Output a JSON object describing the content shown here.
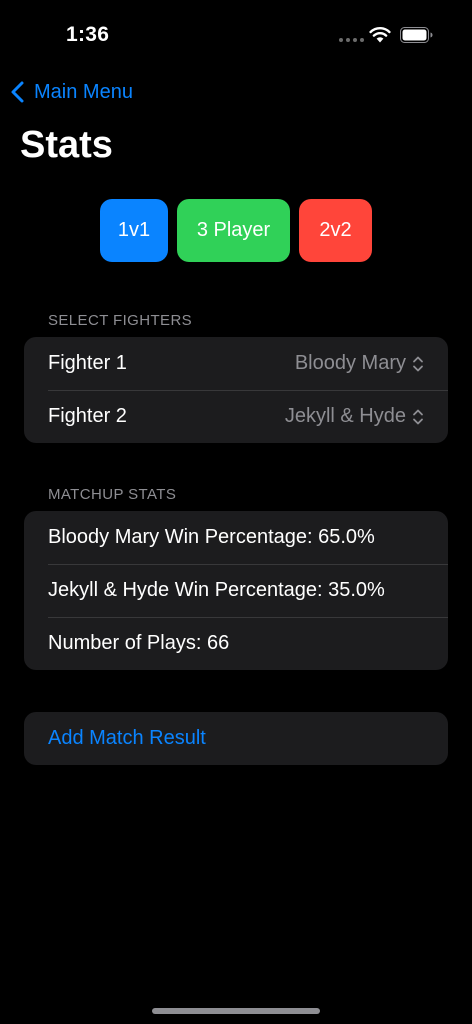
{
  "status_bar": {
    "time": "1:36"
  },
  "nav": {
    "back_label": "Main Menu",
    "title": "Stats"
  },
  "modes": [
    {
      "label": "1v1",
      "color": "#0a84ff"
    },
    {
      "label": "3 Player",
      "color": "#30d158"
    },
    {
      "label": "2v2",
      "color": "#ff453a"
    }
  ],
  "select_fighters": {
    "header": "SELECT FIGHTERS",
    "rows": [
      {
        "label": "Fighter 1",
        "value": "Bloody Mary"
      },
      {
        "label": "Fighter 2",
        "value": "Jekyll & Hyde"
      }
    ]
  },
  "matchup_stats": {
    "header": "MATCHUP STATS",
    "rows": [
      "Bloody Mary Win Percentage: 65.0%",
      "Jekyll & Hyde Win Percentage: 35.0%",
      "Number of Plays: 66"
    ]
  },
  "actions": {
    "add_match": "Add Match Result"
  },
  "colors": {
    "accent": "#0a84ff",
    "background": "#000000",
    "cell": "#1c1c1e",
    "secondary_text": "#8e8e93"
  },
  "icons": [
    "wifi-icon",
    "battery-icon",
    "chevron-left-icon",
    "chevron-up-down-icon"
  ]
}
